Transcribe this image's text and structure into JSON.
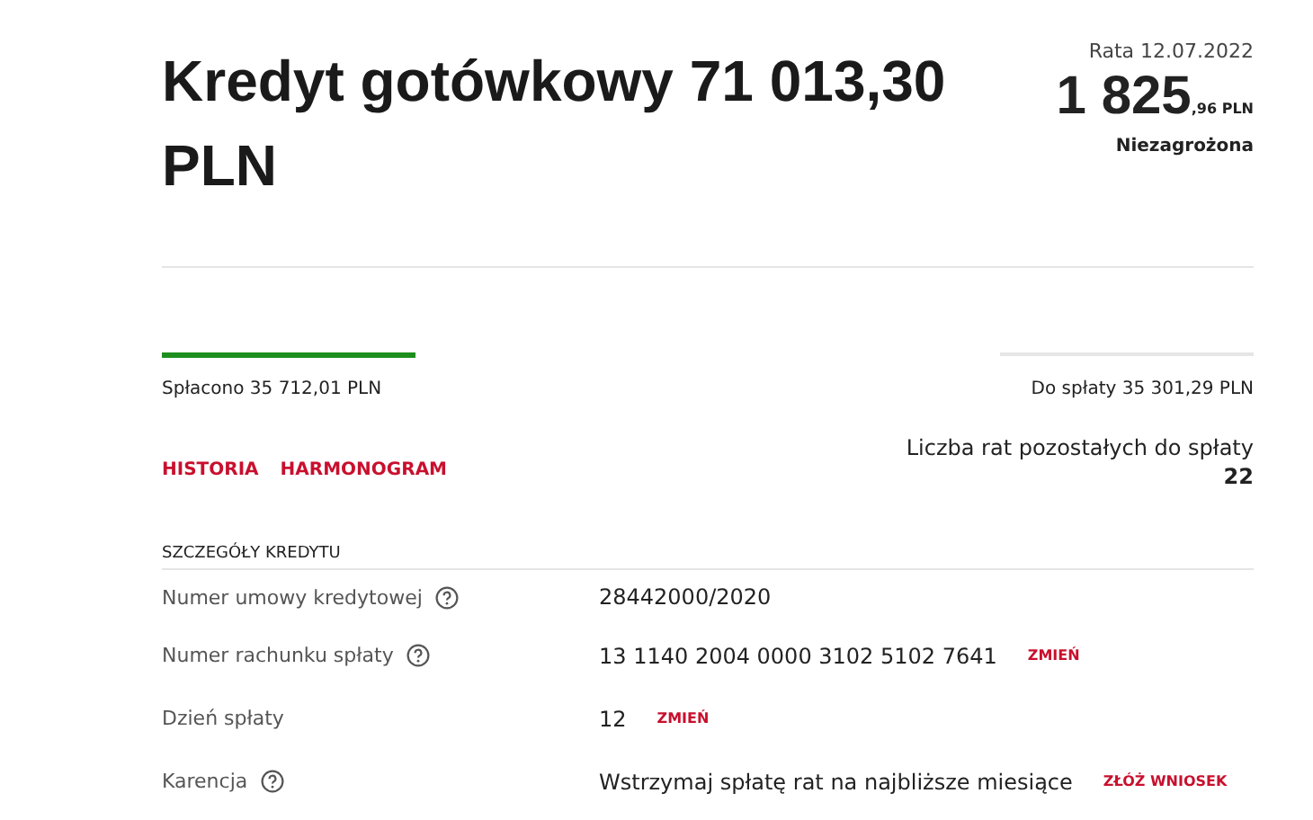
{
  "title": "Kredyt gotówkowy 71 013,30 PLN",
  "installment": {
    "date_label": "Rata 12.07.2022",
    "amount_main": "1 825",
    "amount_fraction": ",96 PLN",
    "status": "Niezagrożona"
  },
  "paid": "Spłacono 35 712,01 PLN",
  "remaining": "Do spłaty 35 301,29 PLN",
  "links": [
    "HISTORIA",
    "HARMONOGRAM"
  ],
  "installments_left": {
    "label": "Liczba rat pozostałych do spłaty",
    "value": "22"
  },
  "details": {
    "heading": "SZCZEGÓŁY KREDYTU",
    "rows": [
      {
        "label": "Numer umowy kredytowej",
        "help": true,
        "value": "28442000/2020"
      },
      {
        "label": "Numer rachunku spłaty",
        "help": true,
        "value": "13 1140 2004 0000 3102 5102 7641",
        "action": "ZMIEŃ"
      },
      {
        "label": "Dzień spłaty",
        "help": false,
        "value": "12",
        "action": "ZMIEŃ"
      },
      {
        "label": "Karencja",
        "help": true,
        "value": "Wstrzymaj spłatę rat na najbliższe miesiące",
        "action": "ZŁÓŻ WNIOSEK"
      }
    ]
  }
}
